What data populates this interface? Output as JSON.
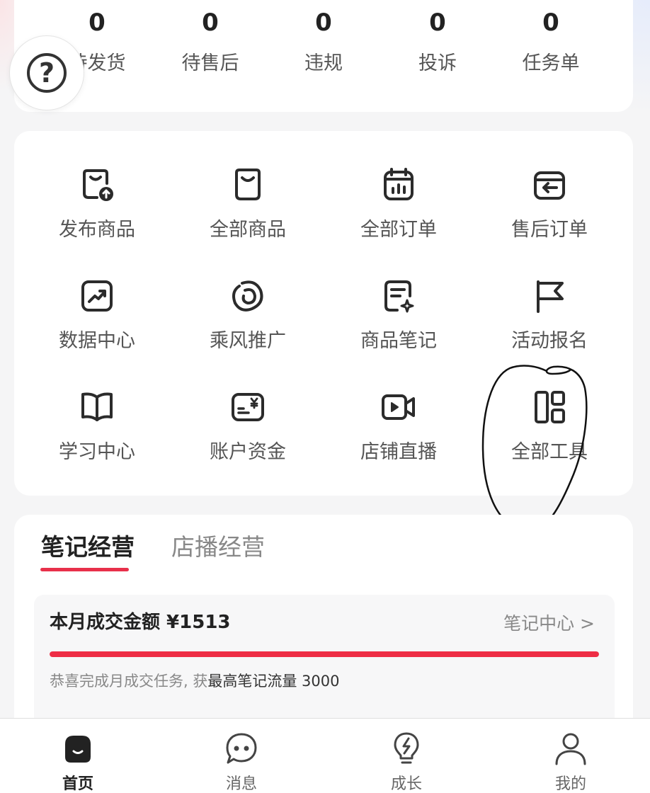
{
  "stats": [
    {
      "value": "0",
      "label": "待发货"
    },
    {
      "value": "0",
      "label": "待售后"
    },
    {
      "value": "0",
      "label": "违规"
    },
    {
      "value": "0",
      "label": "投诉"
    },
    {
      "value": "0",
      "label": "任务单"
    }
  ],
  "help": {
    "symbol": "?",
    "icon": "help-icon"
  },
  "tools": [
    {
      "label": "发布商品",
      "icon": "publish-product-icon"
    },
    {
      "label": "全部商品",
      "icon": "all-products-icon"
    },
    {
      "label": "全部订单",
      "icon": "all-orders-icon"
    },
    {
      "label": "售后订单",
      "icon": "after-sale-orders-icon"
    },
    {
      "label": "数据中心",
      "icon": "data-center-icon"
    },
    {
      "label": "乘风推广",
      "icon": "promotion-icon"
    },
    {
      "label": "商品笔记",
      "icon": "product-notes-icon"
    },
    {
      "label": "活动报名",
      "icon": "flag-icon"
    },
    {
      "label": "学习中心",
      "icon": "book-icon"
    },
    {
      "label": "账户资金",
      "icon": "account-funds-icon"
    },
    {
      "label": "店铺直播",
      "icon": "video-icon"
    },
    {
      "label": "全部工具",
      "icon": "grid-tools-icon"
    }
  ],
  "business": {
    "tabs": [
      "笔记经营",
      "店播经营"
    ],
    "active_tab": "笔记经营",
    "panel": {
      "title": "本月成交金额 ¥1513",
      "link": "笔记中心 >",
      "progress": 1.0,
      "note_prefix": "恭喜完成月成交任务, 获",
      "note_highlight": "最高笔记流量 3000"
    }
  },
  "nav": [
    {
      "label": "首页",
      "icon": "home-icon",
      "active": true
    },
    {
      "label": "消息",
      "icon": "message-icon",
      "active": false
    },
    {
      "label": "成长",
      "icon": "growth-icon",
      "active": false
    },
    {
      "label": "我的",
      "icon": "profile-icon",
      "active": false
    }
  ],
  "colors": {
    "accent": "#ee2d45",
    "progress_track": "#f3d0d5"
  }
}
